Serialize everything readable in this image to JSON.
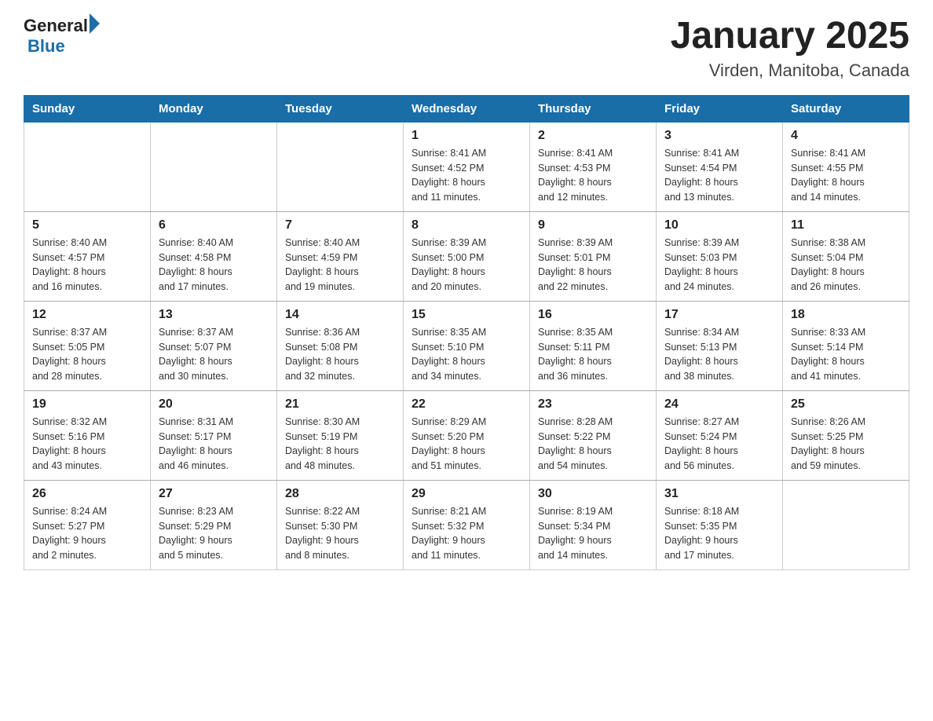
{
  "header": {
    "logo_general": "General",
    "logo_blue": "Blue",
    "title": "January 2025",
    "subtitle": "Virden, Manitoba, Canada"
  },
  "days_of_week": [
    "Sunday",
    "Monday",
    "Tuesday",
    "Wednesday",
    "Thursday",
    "Friday",
    "Saturday"
  ],
  "weeks": [
    [
      {
        "num": "",
        "info": ""
      },
      {
        "num": "",
        "info": ""
      },
      {
        "num": "",
        "info": ""
      },
      {
        "num": "1",
        "info": "Sunrise: 8:41 AM\nSunset: 4:52 PM\nDaylight: 8 hours\nand 11 minutes."
      },
      {
        "num": "2",
        "info": "Sunrise: 8:41 AM\nSunset: 4:53 PM\nDaylight: 8 hours\nand 12 minutes."
      },
      {
        "num": "3",
        "info": "Sunrise: 8:41 AM\nSunset: 4:54 PM\nDaylight: 8 hours\nand 13 minutes."
      },
      {
        "num": "4",
        "info": "Sunrise: 8:41 AM\nSunset: 4:55 PM\nDaylight: 8 hours\nand 14 minutes."
      }
    ],
    [
      {
        "num": "5",
        "info": "Sunrise: 8:40 AM\nSunset: 4:57 PM\nDaylight: 8 hours\nand 16 minutes."
      },
      {
        "num": "6",
        "info": "Sunrise: 8:40 AM\nSunset: 4:58 PM\nDaylight: 8 hours\nand 17 minutes."
      },
      {
        "num": "7",
        "info": "Sunrise: 8:40 AM\nSunset: 4:59 PM\nDaylight: 8 hours\nand 19 minutes."
      },
      {
        "num": "8",
        "info": "Sunrise: 8:39 AM\nSunset: 5:00 PM\nDaylight: 8 hours\nand 20 minutes."
      },
      {
        "num": "9",
        "info": "Sunrise: 8:39 AM\nSunset: 5:01 PM\nDaylight: 8 hours\nand 22 minutes."
      },
      {
        "num": "10",
        "info": "Sunrise: 8:39 AM\nSunset: 5:03 PM\nDaylight: 8 hours\nand 24 minutes."
      },
      {
        "num": "11",
        "info": "Sunrise: 8:38 AM\nSunset: 5:04 PM\nDaylight: 8 hours\nand 26 minutes."
      }
    ],
    [
      {
        "num": "12",
        "info": "Sunrise: 8:37 AM\nSunset: 5:05 PM\nDaylight: 8 hours\nand 28 minutes."
      },
      {
        "num": "13",
        "info": "Sunrise: 8:37 AM\nSunset: 5:07 PM\nDaylight: 8 hours\nand 30 minutes."
      },
      {
        "num": "14",
        "info": "Sunrise: 8:36 AM\nSunset: 5:08 PM\nDaylight: 8 hours\nand 32 minutes."
      },
      {
        "num": "15",
        "info": "Sunrise: 8:35 AM\nSunset: 5:10 PM\nDaylight: 8 hours\nand 34 minutes."
      },
      {
        "num": "16",
        "info": "Sunrise: 8:35 AM\nSunset: 5:11 PM\nDaylight: 8 hours\nand 36 minutes."
      },
      {
        "num": "17",
        "info": "Sunrise: 8:34 AM\nSunset: 5:13 PM\nDaylight: 8 hours\nand 38 minutes."
      },
      {
        "num": "18",
        "info": "Sunrise: 8:33 AM\nSunset: 5:14 PM\nDaylight: 8 hours\nand 41 minutes."
      }
    ],
    [
      {
        "num": "19",
        "info": "Sunrise: 8:32 AM\nSunset: 5:16 PM\nDaylight: 8 hours\nand 43 minutes."
      },
      {
        "num": "20",
        "info": "Sunrise: 8:31 AM\nSunset: 5:17 PM\nDaylight: 8 hours\nand 46 minutes."
      },
      {
        "num": "21",
        "info": "Sunrise: 8:30 AM\nSunset: 5:19 PM\nDaylight: 8 hours\nand 48 minutes."
      },
      {
        "num": "22",
        "info": "Sunrise: 8:29 AM\nSunset: 5:20 PM\nDaylight: 8 hours\nand 51 minutes."
      },
      {
        "num": "23",
        "info": "Sunrise: 8:28 AM\nSunset: 5:22 PM\nDaylight: 8 hours\nand 54 minutes."
      },
      {
        "num": "24",
        "info": "Sunrise: 8:27 AM\nSunset: 5:24 PM\nDaylight: 8 hours\nand 56 minutes."
      },
      {
        "num": "25",
        "info": "Sunrise: 8:26 AM\nSunset: 5:25 PM\nDaylight: 8 hours\nand 59 minutes."
      }
    ],
    [
      {
        "num": "26",
        "info": "Sunrise: 8:24 AM\nSunset: 5:27 PM\nDaylight: 9 hours\nand 2 minutes."
      },
      {
        "num": "27",
        "info": "Sunrise: 8:23 AM\nSunset: 5:29 PM\nDaylight: 9 hours\nand 5 minutes."
      },
      {
        "num": "28",
        "info": "Sunrise: 8:22 AM\nSunset: 5:30 PM\nDaylight: 9 hours\nand 8 minutes."
      },
      {
        "num": "29",
        "info": "Sunrise: 8:21 AM\nSunset: 5:32 PM\nDaylight: 9 hours\nand 11 minutes."
      },
      {
        "num": "30",
        "info": "Sunrise: 8:19 AM\nSunset: 5:34 PM\nDaylight: 9 hours\nand 14 minutes."
      },
      {
        "num": "31",
        "info": "Sunrise: 8:18 AM\nSunset: 5:35 PM\nDaylight: 9 hours\nand 17 minutes."
      },
      {
        "num": "",
        "info": ""
      }
    ]
  ]
}
